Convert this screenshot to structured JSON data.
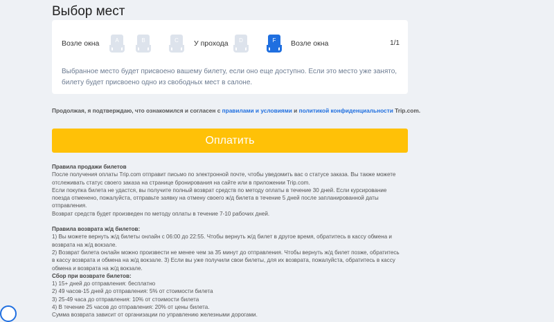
{
  "section_title": "Выбор мест",
  "seat_row": {
    "left_label": "Возле окна",
    "aisle_label": "У прохода",
    "right_label": "Возле окна",
    "count": "1/1",
    "seats": [
      {
        "letter": "A",
        "selected": false
      },
      {
        "letter": "B",
        "selected": false
      },
      {
        "letter": "C",
        "selected": false
      },
      {
        "letter": "D",
        "selected": false
      },
      {
        "letter": "F",
        "selected": true
      }
    ]
  },
  "note": "Выбранное место будет присвоено вашему билету, если оно еще доступно. Если это место уже занято, билету будет присвоено одно из свободных мест в салоне.",
  "agreement": {
    "prefix": "Продолжая, я подтверждаю, что ознакомился и согласен с ",
    "link1": "правилами и условиями",
    "middle": " и ",
    "link2": "политикой конфиденциальности",
    "suffix": " Trip.com."
  },
  "pay_button": "Оплатить",
  "rules": {
    "sale_title": "Правила продажи билетов",
    "sale_lines": [
      "После получения оплаты Trip.com отправит письмо по электронной почте, чтобы уведомить вас о статусе заказа. Вы также можете отслеживать статус своего заказа на странице бронирования на сайте или в приложении Trip.com.",
      "Если покупка билета не удастся, вы получите полный возврат средств по методу оплаты в течение 30 дней. Если курсирование поезда отменено, пожалуйста, отправьте заявку на отмену своего ж/д билета в течение 5 дней после запланированной даты отправления.",
      "Возврат средств будет произведен по методу оплаты в течение 7-10 рабочих дней."
    ],
    "refund_title": "Правила возврата ж/д билетов:",
    "refund_lines": [
      "1) Вы можете вернуть ж/д билеты онлайн с 06:00 до 22:55. Чтобы вернуть ж/д билет в другое время, обратитесь в кассу обмена и возврата на ж/д вокзале.",
      "2) Возврат билета онлайн можно произвести не менее чем за 35 минут до отправления. Чтобы вернуть ж/д билет позже, обратитесь в кассу возврата и обмена на ж/д вокзале. 3) Если вы уже получили свои билеты, для их возврата, пожалуйста, обратитесь в кассу обмена и возврата на ж/д вокзале."
    ],
    "fee_title": "Сбор при возврате билетов:",
    "fee_lines": [
      "1) 15+ дней до отправления: бесплатно",
      "2) 49 часов-15 дней до отправления: 5% от стоимости билета",
      "3) 25-49 часа до отправления: 10% от стоимости билета",
      "4) В течение 25 часов до отправления: 20% от цены билета.",
      "Сумма возврата зависит от организации по управлению железными дорогами."
    ]
  },
  "colors": {
    "accent": "#1f6fe0",
    "pay": "#ffc107",
    "seat_disabled": "#dde3ec"
  }
}
